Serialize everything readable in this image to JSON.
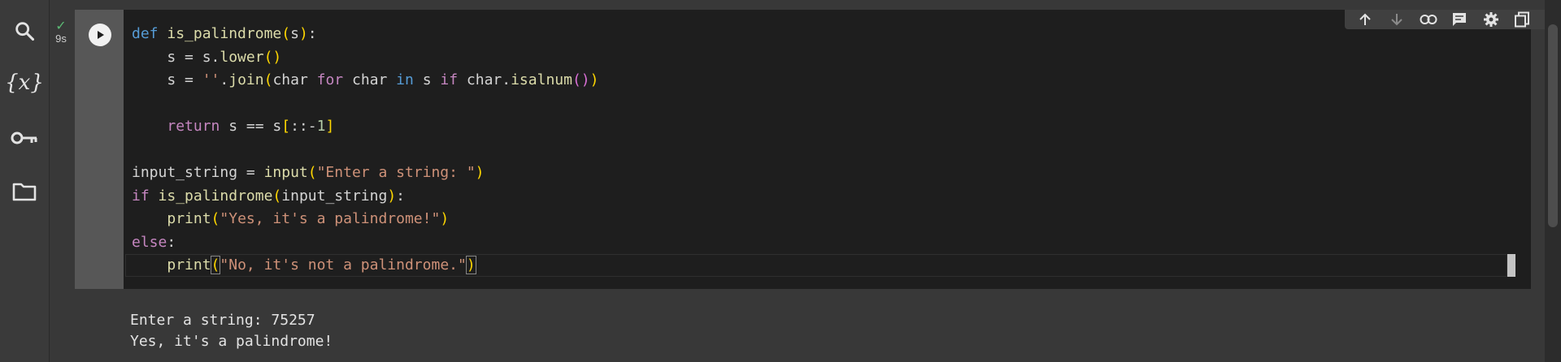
{
  "sidebar": {
    "items": [
      {
        "name": "search-icon"
      },
      {
        "name": "variables-icon",
        "label": "{x}"
      },
      {
        "name": "key-icon"
      },
      {
        "name": "folder-icon"
      }
    ]
  },
  "cell": {
    "exec_time": "9s",
    "status": "success",
    "accent_success": "#5bb974",
    "code_lines": [
      "def is_palindrome(s):",
      "    s = s.lower()",
      "    s = ''.join(char for char in s if char.isalnum())",
      "",
      "    return s == s[::-1]",
      "",
      "input_string = input(\"Enter a string: \")",
      "if is_palindrome(input_string):",
      "    print(\"Yes, it's a palindrome!\")",
      "else:",
      "    print(\"No, it's not a palindrome.\")"
    ],
    "output_lines": [
      "Enter a string: 75257",
      "Yes, it's a palindrome!"
    ]
  },
  "toolbar": {
    "icons": [
      "arrow-up-icon",
      "arrow-down-icon",
      "link-icon",
      "comment-icon",
      "gear-icon",
      "mirror-cell-icon",
      "trash-icon",
      "more-vert-icon"
    ]
  }
}
